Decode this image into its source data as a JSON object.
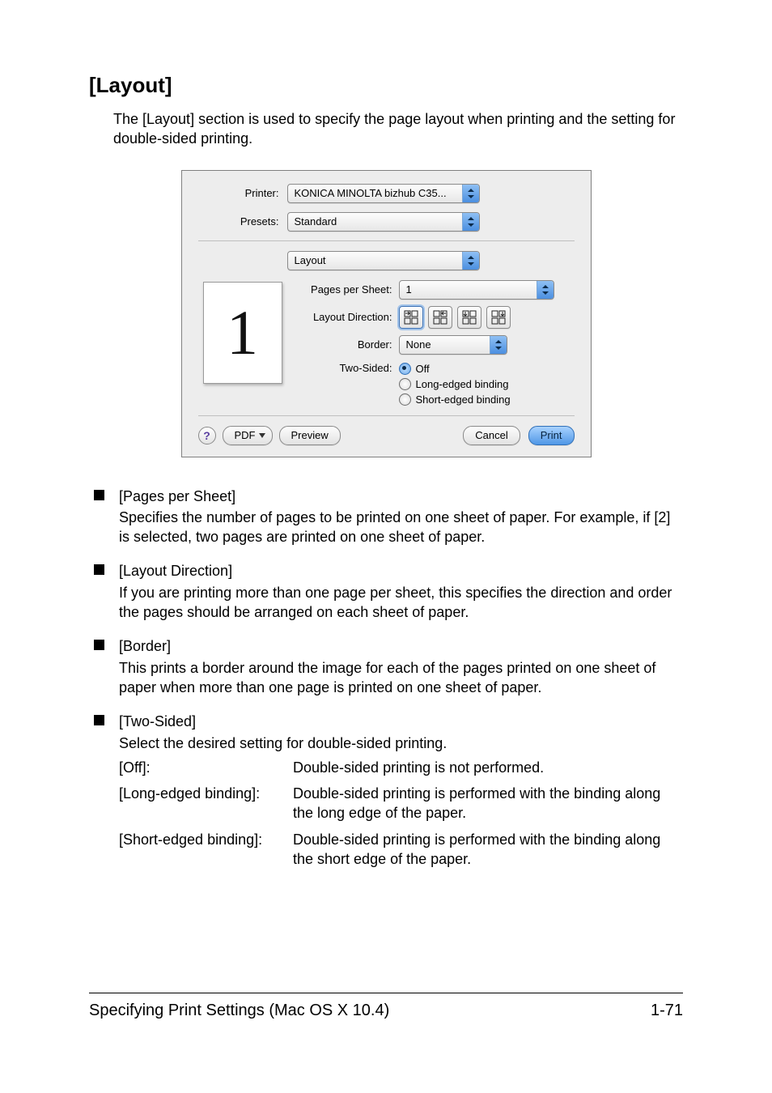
{
  "heading": "[Layout]",
  "intro": "The [Layout] section is used to specify the page layout when printing and the setting for double-sided printing.",
  "dialog": {
    "printer_label": "Printer:",
    "printer_value": "KONICA MINOLTA bizhub C35...",
    "presets_label": "Presets:",
    "presets_value": "Standard",
    "section_value": "Layout",
    "pages_per_sheet_label": "Pages per Sheet:",
    "pages_per_sheet_value": "1",
    "layout_direction_label": "Layout Direction:",
    "border_label": "Border:",
    "border_value": "None",
    "two_sided_label": "Two-Sided:",
    "two_sided_options": {
      "off": "Off",
      "long": "Long-edged binding",
      "short": "Short-edged binding"
    },
    "preview_number": "1",
    "help": "?",
    "pdf_btn": "PDF",
    "preview_btn": "Preview",
    "cancel_btn": "Cancel",
    "print_btn": "Print"
  },
  "bullets": {
    "pages_per_sheet": {
      "title": "[Pages per Sheet]",
      "desc": "Specifies the number of pages to be printed on one sheet of paper. For example, if [2] is selected, two pages are printed on one sheet of paper."
    },
    "layout_direction": {
      "title": "[Layout Direction]",
      "desc": "If you are printing more than one page per sheet, this specifies the direction and order the pages should be arranged on each sheet of paper."
    },
    "border": {
      "title": "[Border]",
      "desc": "This prints a border around the image for each of the pages printed on one sheet of paper when more than one page is printed on one sheet of paper."
    },
    "two_sided": {
      "title": "[Two-Sided]",
      "desc": "Select the desired setting for double-sided printing.",
      "rows": {
        "off_key": "[Off]:",
        "off_val": "Double-sided printing is not performed.",
        "long_key": "[Long-edged binding]:",
        "long_val": "Double-sided printing is performed with the binding along the long edge of the paper.",
        "short_key": "[Short-edged binding]:",
        "short_val": "Double-sided printing is performed with the binding along the short edge of the paper."
      }
    }
  },
  "footer": {
    "left": "Specifying Print Settings (Mac OS X 10.4)",
    "right": "1-71"
  }
}
